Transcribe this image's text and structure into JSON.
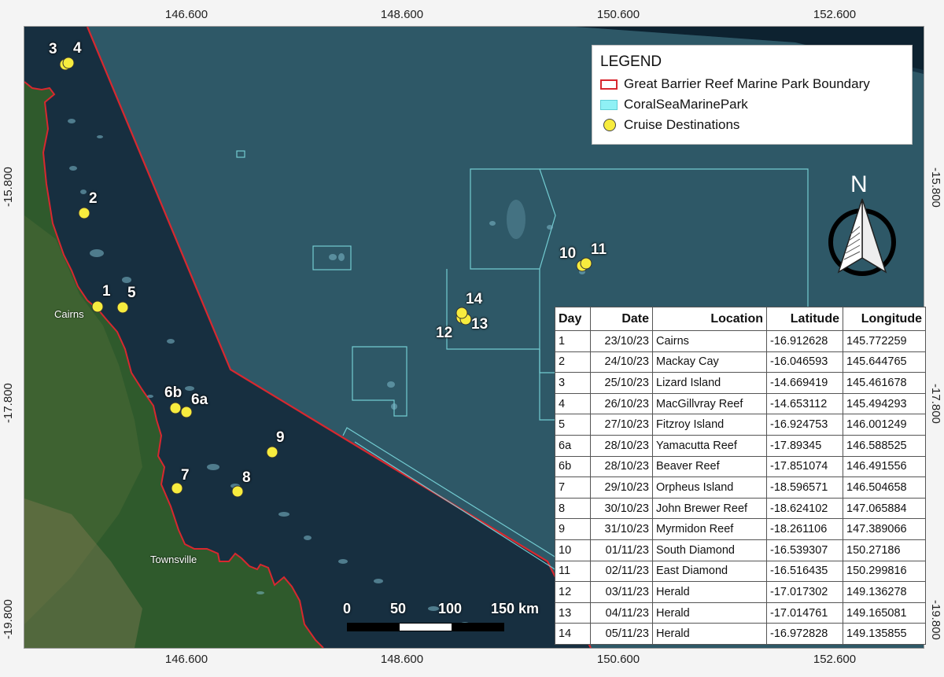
{
  "map": {
    "tick_labels": {
      "top": [
        "146.600",
        "148.600",
        "150.600",
        "152.600"
      ],
      "bottom": [
        "146.600",
        "148.600",
        "150.600",
        "152.600"
      ],
      "left": [
        "-15.800",
        "-17.800",
        "-19.800"
      ],
      "right": [
        "-15.800",
        "-17.800",
        "-19.800"
      ]
    },
    "place_labels": {
      "cairns": "Cairns",
      "townsville": "Townsville"
    },
    "colors": {
      "boundary": "#d8282f",
      "coral_sea_park": "#8ff1f5",
      "marker": "#f7ec3e",
      "sea": "#173445",
      "land": "#2f5a2c"
    },
    "north_arrow": {
      "label": "N",
      "icon": "north-arrow-icon"
    },
    "scale_bar": {
      "labels": [
        "0",
        "50",
        "100",
        "150 km"
      ]
    },
    "markers": [
      {
        "labels": [
          "1"
        ]
      },
      {
        "labels": [
          "2"
        ]
      },
      {
        "labels": [
          "3",
          "4"
        ]
      },
      {
        "labels": [
          "5"
        ]
      },
      {
        "labels": [
          "6b",
          "6a"
        ]
      },
      {
        "labels": [
          "7"
        ]
      },
      {
        "labels": [
          "8"
        ]
      },
      {
        "labels": [
          "9"
        ]
      },
      {
        "labels": [
          "10",
          "11"
        ]
      },
      {
        "labels": [
          "12",
          "13",
          "14"
        ]
      }
    ]
  },
  "legend": {
    "title": "LEGEND",
    "items": [
      {
        "label": "Great Barrier Reef Marine Park Boundary",
        "icon": "boundary-swatch"
      },
      {
        "label": "CoralSeaMarinePark",
        "icon": "coral-sea-swatch"
      },
      {
        "label": "Cruise Destinations",
        "icon": "dot-swatch"
      }
    ]
  },
  "table": {
    "headers": [
      "Day",
      "Date",
      "Location",
      "Latitude",
      "Longitude"
    ],
    "rows": [
      [
        "1",
        "23/10/23",
        "Cairns",
        "-16.912628",
        "145.772259"
      ],
      [
        "2",
        "24/10/23",
        "Mackay Cay",
        "-16.046593",
        "145.644765"
      ],
      [
        "3",
        "25/10/23",
        "Lizard Island",
        "-14.669419",
        "145.461678"
      ],
      [
        "4",
        "26/10/23",
        "MacGillvray Reef",
        "-14.653112",
        "145.494293"
      ],
      [
        "5",
        "27/10/23",
        "Fitzroy Island",
        "-16.924753",
        "146.001249"
      ],
      [
        "6a",
        "28/10/23",
        "Yamacutta Reef",
        "-17.89345",
        "146.588525"
      ],
      [
        "6b",
        "28/10/23",
        "Beaver Reef",
        "-17.851074",
        "146.491556"
      ],
      [
        "7",
        "29/10/23",
        "Orpheus Island",
        "-18.596571",
        "146.504658"
      ],
      [
        "8",
        "30/10/23",
        "John Brewer Reef",
        "-18.624102",
        "147.065884"
      ],
      [
        "9",
        "31/10/23",
        "Myrmidon Reef",
        "-18.261106",
        "147.389066"
      ],
      [
        "10",
        "01/11/23",
        "South Diamond",
        "-16.539307",
        "150.27186"
      ],
      [
        "11",
        "02/11/23",
        "East Diamond",
        "-16.516435",
        "150.299816"
      ],
      [
        "12",
        "03/11/23",
        "Herald",
        "-17.017302",
        "149.136278"
      ],
      [
        "13",
        "04/11/23",
        "Herald",
        "-17.014761",
        "149.165081"
      ],
      [
        "14",
        "05/11/23",
        "Herald",
        "-16.972828",
        "149.135855"
      ]
    ]
  }
}
